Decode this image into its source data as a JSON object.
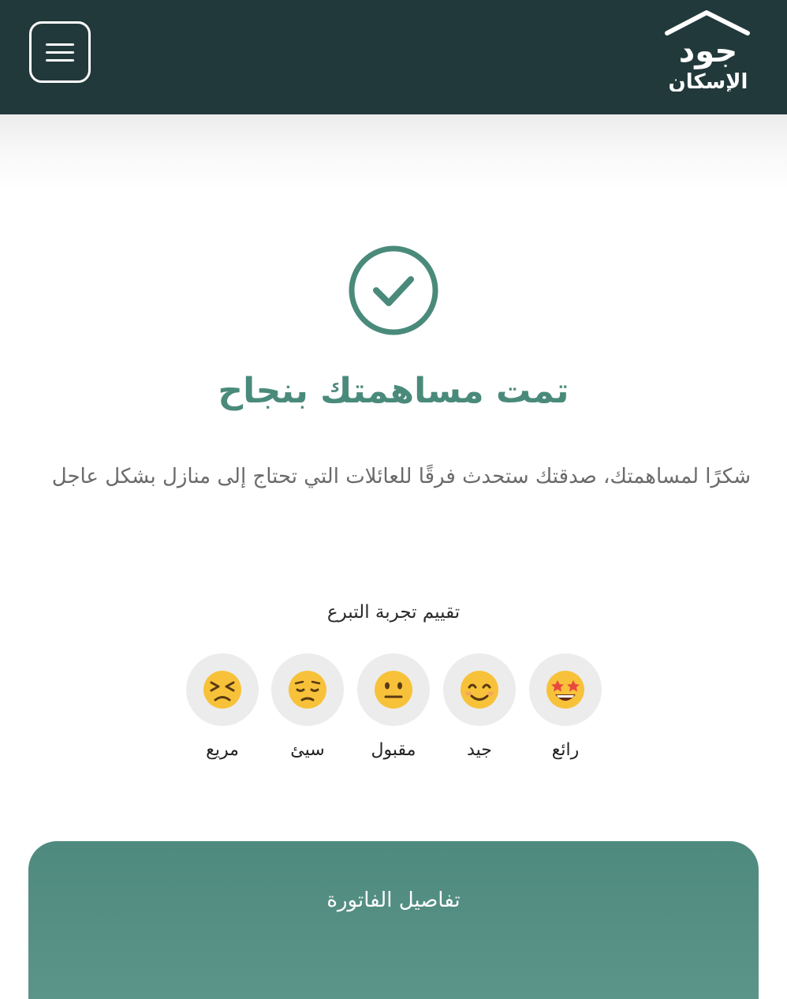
{
  "header": {
    "logo_line1": "جود",
    "logo_line2": "الإسكان",
    "menu_icon": "hamburger-menu-icon",
    "background_color": "#22393b"
  },
  "success": {
    "icon": "check-circle-icon",
    "title": "تمت مساهمتك بنجاح",
    "message": "شكرًا لمساهمتك، صدقتك ستحدث فرقًا للعائلات التي تحتاج إلى منازل بشكل عاجل"
  },
  "rating": {
    "title": "تقييم تجربة التبرع",
    "options": [
      {
        "label": "رائع",
        "icon": "star-struck-emoji-icon"
      },
      {
        "label": "جيد",
        "icon": "smiling-emoji-icon"
      },
      {
        "label": "مقبول",
        "icon": "neutral-emoji-icon"
      },
      {
        "label": "سيئ",
        "icon": "pensive-emoji-icon"
      },
      {
        "label": "مريع",
        "icon": "persevering-emoji-icon"
      }
    ]
  },
  "invoice": {
    "title": "تفاصيل الفاتورة"
  },
  "colors": {
    "accent": "#4a8a7b",
    "card": "#528d81"
  }
}
